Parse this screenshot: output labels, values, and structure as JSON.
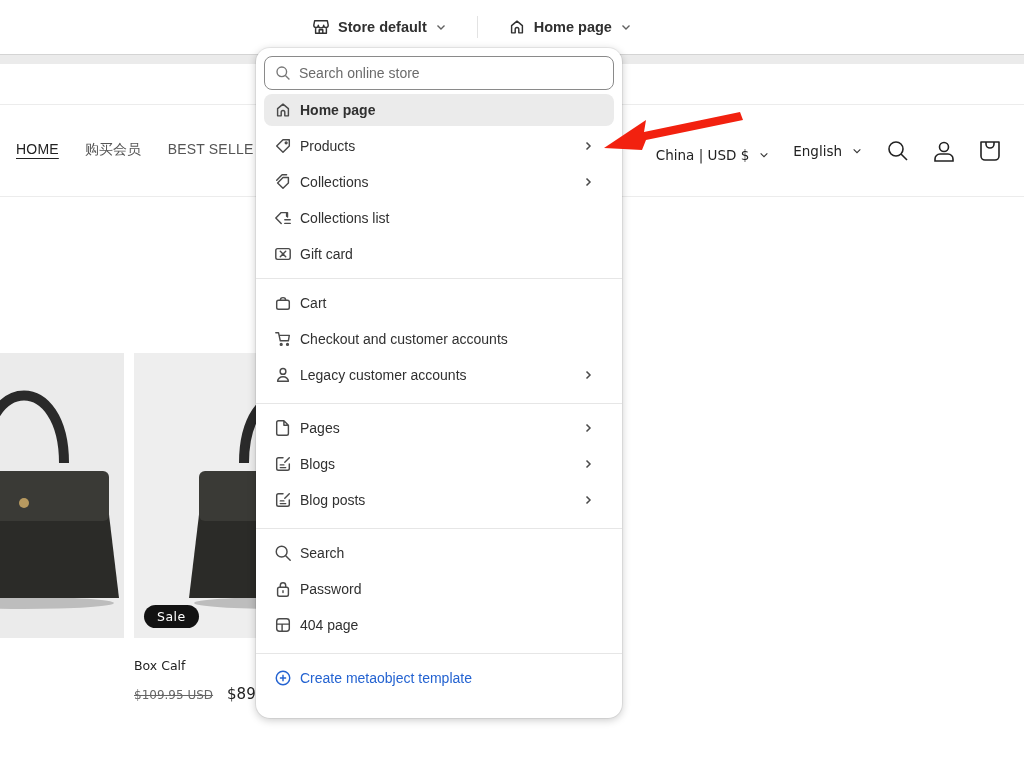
{
  "top_bar": {
    "theme_selector": "Store default",
    "page_selector": "Home page"
  },
  "storefront": {
    "nav": [
      {
        "label": "HOME",
        "selected": true
      },
      {
        "label": "购买会员",
        "selected": false
      },
      {
        "label": "BEST SELLE",
        "selected": false
      }
    ],
    "country_selector": "China | USD $",
    "language_selector": "English",
    "products": [
      {
        "kind": "picture"
      },
      {
        "kind": "picture",
        "badge": "Sale",
        "title": "Box Calf",
        "compare_price": "$109.95 USD",
        "price": "$89"
      }
    ]
  },
  "menu": {
    "search": {
      "placeholder": "Search online store"
    },
    "groups": [
      {
        "items": [
          {
            "label": "Home page",
            "selected": true,
            "submenu": false
          },
          {
            "label": "Products",
            "selected": false,
            "submenu": true
          },
          {
            "label": "Collections",
            "selected": false,
            "submenu": true
          },
          {
            "label": "Collections list",
            "selected": false,
            "submenu": false
          },
          {
            "label": "Gift card",
            "selected": false,
            "submenu": false
          }
        ]
      },
      {
        "items": [
          {
            "label": "Cart",
            "selected": false,
            "submenu": false
          },
          {
            "label": "Checkout and customer accounts",
            "selected": false,
            "submenu": false
          },
          {
            "label": "Legacy customer accounts",
            "selected": false,
            "submenu": true
          }
        ]
      },
      {
        "items": [
          {
            "label": "Pages",
            "selected": false,
            "submenu": true
          },
          {
            "label": "Blogs",
            "selected": false,
            "submenu": true
          },
          {
            "label": "Blog posts",
            "selected": false,
            "submenu": true
          }
        ]
      },
      {
        "items": [
          {
            "label": "Search",
            "selected": false,
            "submenu": false
          },
          {
            "label": "Password",
            "selected": false,
            "submenu": false
          },
          {
            "label": "404 page",
            "selected": false,
            "submenu": false
          }
        ]
      }
    ],
    "action": "Create metaobject template"
  }
}
